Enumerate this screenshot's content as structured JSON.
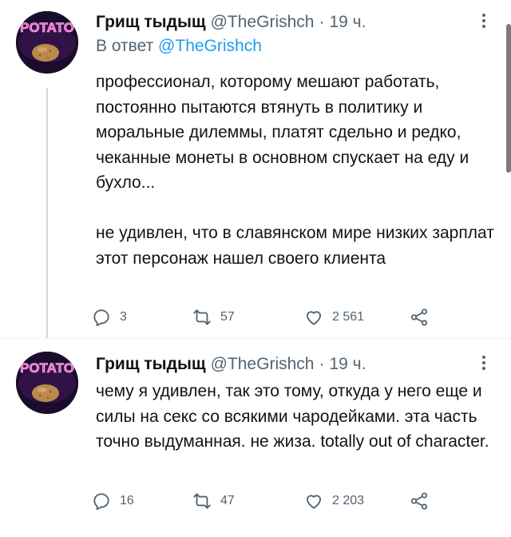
{
  "tweets": [
    {
      "author": {
        "name": "Грищ тыдыщ",
        "handle": "@TheGrishch",
        "avatar_text": "POTATO"
      },
      "separator": "·",
      "time": "19 ч.",
      "reply_prefix": "В ответ",
      "reply_handle": "@TheGrishch",
      "paragraphs": [
        "профессионал, которому мешают работать, постоянно пытаются втянуть в политику и моральные дилеммы, платят сдельно и редко, чеканные монеты в основном спускает на еду и бухло...",
        "не удивлен, что в славянском мире низких зарплат этот персонаж нашел своего клиента"
      ],
      "stats": {
        "replies": "3",
        "retweets": "57",
        "likes": "2 561"
      }
    },
    {
      "author": {
        "name": "Грищ тыдыщ",
        "handle": "@TheGrishch",
        "avatar_text": "POTATO"
      },
      "separator": "·",
      "time": "19 ч.",
      "paragraphs": [
        "чему я удивлен, так это тому, откуда у него еще и силы на секс со всякими чародейками. эта часть точно выдуманная. не жиза. totally out of character."
      ],
      "stats": {
        "replies": "16",
        "retweets": "47",
        "likes": "2 203"
      }
    }
  ],
  "colors": {
    "text": "#0f1419",
    "secondary": "#536471",
    "link": "#1d9bf0",
    "thread_line": "#cfd9de",
    "avatar_bg": "#1a0d2b",
    "avatar_glow": "#ff3ec8"
  },
  "icons": [
    "more-icon",
    "reply-icon",
    "retweet-icon",
    "like-icon",
    "share-icon"
  ]
}
